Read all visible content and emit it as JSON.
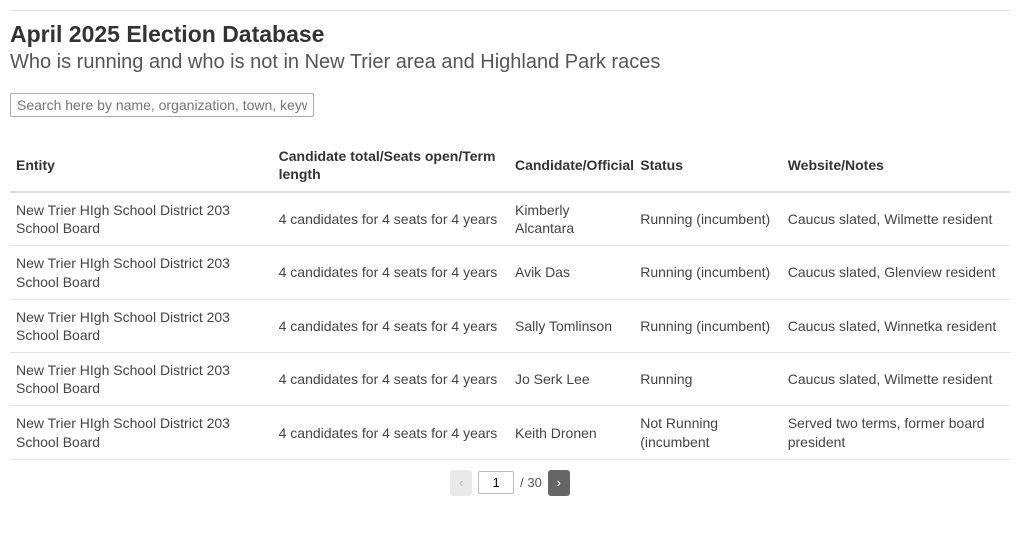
{
  "header": {
    "title": "April 2025 Election Database",
    "subtitle": "Who is running and who is not in New Trier area and Highland Park races"
  },
  "search": {
    "placeholder": "Search here by name, organization, town, keyword",
    "value": ""
  },
  "columns": {
    "entity": "Entity",
    "seats": "Candidate total/Seats open/Term length",
    "candidate": "Candidate/Official",
    "status": "Status",
    "notes": "Website/Notes"
  },
  "rows": [
    {
      "entity": "New Trier HIgh School District 203 School Board",
      "seats": "4 candidates for 4 seats for 4 years",
      "candidate": "Kimberly Alcantara",
      "status": "Running (incumbent)",
      "notes": "Caucus slated, Wilmette resident"
    },
    {
      "entity": "New Trier HIgh School District 203 School Board",
      "seats": "4 candidates for 4 seats for 4 years",
      "candidate": "Avik Das",
      "status": "Running (incumbent)",
      "notes": "Caucus slated, Glenview resident"
    },
    {
      "entity": "New Trier HIgh School District 203 School Board",
      "seats": "4 candidates for 4 seats for 4 years",
      "candidate": "Sally Tomlinson",
      "status": "Running (incumbent)",
      "notes": "Caucus slated, Winnetka resident"
    },
    {
      "entity": "New Trier HIgh School District 203 School Board",
      "seats": "4 candidates for 4 seats for 4 years",
      "candidate": "Jo Serk Lee",
      "status": "Running",
      "notes": "Caucus slated, Wilmette resident"
    },
    {
      "entity": "New Trier HIgh School District 203 School Board",
      "seats": "4 candidates for 4 seats for 4 years",
      "candidate": "Keith Dronen",
      "status": "Not Running (incumbent",
      "notes": "Served two terms, former board president"
    }
  ],
  "pager": {
    "prev": "‹",
    "next": "›",
    "current": "1",
    "total": "/ 30"
  }
}
